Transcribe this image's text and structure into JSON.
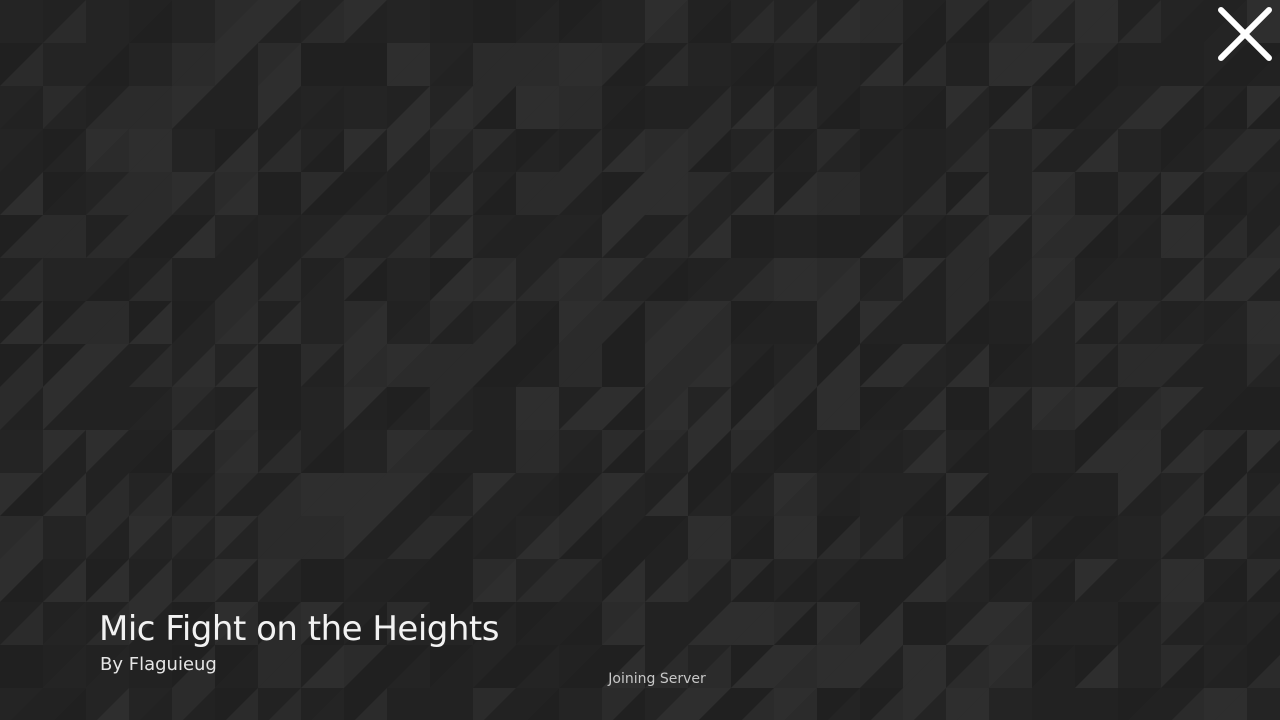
{
  "loading_screen": {
    "background_color": "#262626",
    "pattern_colors": [
      "#222222",
      "#2b2b2b",
      "#242424",
      "#2e2e2e",
      "#202020"
    ],
    "game_title": "Mic Fight on the Heights",
    "author": "By Flaguieug",
    "status": "Joining Server",
    "close_icon": "close-x-icon"
  }
}
